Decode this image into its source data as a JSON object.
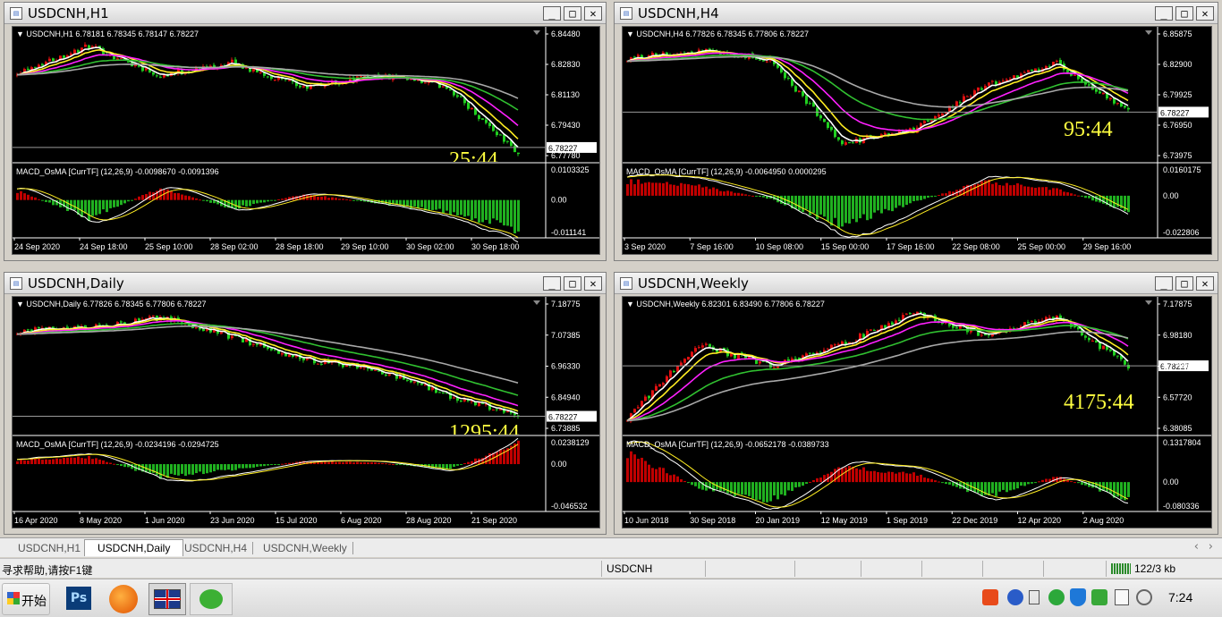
{
  "colors": {
    "up": "#e01010",
    "down": "#20d020",
    "ma_fast": "#ffffff",
    "ma_mid": "#ffee22",
    "ma_pink": "#ff20ff",
    "ma_green": "#30c030",
    "ma_grey": "#a8a8a8",
    "timer": "#ffff40",
    "axis_text": "#ffffff",
    "hist_up": "#c00000",
    "hist_down": "#20b020"
  },
  "windows": [
    {
      "title": "USDCNH,H1",
      "legend": "▼ USDCNH,H1  6.78181 6.78345 6.78147 6.78227",
      "price_label": "6.78227",
      "price_ticks": [
        "6.84480",
        "6.82830",
        "6.81130",
        "6.79430",
        "6.77780"
      ],
      "macd_label": "MACD_OsMA [CurrTF] (12,26,9) -0.0098670 -0.0091396",
      "macd_ticks": [
        "0.0103325",
        "0.00",
        "-0.011141"
      ],
      "timer": "25:44",
      "time_ticks": [
        "24 Sep 2020",
        "24 Sep 18:00",
        "25 Sep 10:00",
        "28 Sep 02:00",
        "28 Sep 18:00",
        "29 Sep 10:00",
        "30 Sep 02:00",
        "30 Sep 18:00"
      ]
    },
    {
      "title": "USDCNH,H4",
      "legend": "▼ USDCNH,H4  6.77826 6.78345 6.77806 6.78227",
      "price_label": "6.78227",
      "price_ticks": [
        "6.85875",
        "6.82900",
        "6.79925",
        "6.76950",
        "6.73975"
      ],
      "macd_label": "MACD_OsMA [CurrTF] (12,26,9) -0.0064950 0.0000295",
      "macd_ticks": [
        "0.0160175",
        "0.00",
        "-0.022806"
      ],
      "timer": "95:44",
      "time_ticks": [
        "3 Sep 2020",
        "7 Sep 16:00",
        "10 Sep 08:00",
        "15 Sep 00:00",
        "17 Sep 16:00",
        "22 Sep 08:00",
        "25 Sep 00:00",
        "29 Sep 16:00"
      ]
    },
    {
      "title": "USDCNH,Daily",
      "legend": "▼ USDCNH,Daily  6.77826 6.78345 6.77806 6.78227",
      "price_label": "6.78227",
      "price_ticks": [
        "7.18775",
        "7.07385",
        "6.96330",
        "6.84940",
        "6.73885"
      ],
      "macd_label": "MACD_OsMA [CurrTF] (12,26,9) -0.0234196 -0.0294725",
      "macd_ticks": [
        "0.0238129",
        "0.00",
        "-0.046532"
      ],
      "timer": "1295:44",
      "time_ticks": [
        "16 Apr 2020",
        "8 May 2020",
        "1 Jun 2020",
        "23 Jun 2020",
        "15 Jul 2020",
        "6 Aug 2020",
        "28 Aug 2020",
        "21 Sep 2020"
      ]
    },
    {
      "title": "USDCNH,Weekly",
      "legend": "▼ USDCNH,Weekly  6.82301 6.83490 6.77806 6.78227",
      "price_label": "6.78227",
      "price_ticks": [
        "7.17875",
        "6.98180",
        "6.77900",
        "6.57720",
        "6.38085"
      ],
      "macd_label": "MACD_OsMA [CurrTF] (12,26,9) -0.0652178 -0.0389733",
      "macd_ticks": [
        "0.1317804",
        "0.00",
        "-0.080336"
      ],
      "timer": "4175:44",
      "time_ticks": [
        "10 Jun 2018",
        "30 Sep 2018",
        "20 Jan 2019",
        "12 May 2019",
        "1 Sep 2019",
        "22 Dec 2019",
        "12 Apr 2020",
        "2 Aug 2020"
      ]
    }
  ],
  "chart_data": [
    {
      "type": "line",
      "title": "USDCNH,H1",
      "symbol": "USDCNH",
      "ohlc_last": {
        "open": 6.78181,
        "high": 6.78345,
        "low": 6.78147,
        "close": 6.78227
      },
      "ylim": [
        6.7778,
        6.8448
      ],
      "x": [
        "24 Sep 2020",
        "24 Sep 18:00",
        "25 Sep 10:00",
        "28 Sep 02:00",
        "28 Sep 18:00",
        "29 Sep 10:00",
        "30 Sep 02:00",
        "30 Sep 18:00"
      ],
      "series": [
        {
          "name": "USDCNH,H1",
          "values": [
            6.824,
            6.838,
            6.822,
            6.829,
            6.815,
            6.822,
            6.816,
            6.779
          ]
        }
      ],
      "macd": {
        "values": [
          0.003,
          -0.006,
          0.004,
          -0.003,
          0.002,
          -0.001,
          -0.004,
          -0.01
        ],
        "ylim": [
          -0.011141,
          0.0103325
        ]
      }
    },
    {
      "type": "line",
      "title": "USDCNH,H4",
      "symbol": "USDCNH",
      "ohlc_last": {
        "open": 6.77826,
        "high": 6.78345,
        "low": 6.77806,
        "close": 6.78227
      },
      "ylim": [
        6.73975,
        6.85875
      ],
      "x": [
        "3 Sep 2020",
        "7 Sep 16:00",
        "10 Sep 08:00",
        "15 Sep 00:00",
        "17 Sep 16:00",
        "22 Sep 08:00",
        "25 Sep 00:00",
        "29 Sep 16:00"
      ],
      "series": [
        {
          "name": "USDCNH,H4",
          "values": [
            6.835,
            6.842,
            6.834,
            6.752,
            6.765,
            6.808,
            6.83,
            6.782
          ]
        }
      ],
      "macd": {
        "values": [
          0.009,
          0.006,
          -0.002,
          -0.018,
          -0.004,
          0.009,
          0.004,
          -0.009
        ],
        "ylim": [
          -0.022806,
          0.0160175
        ]
      }
    },
    {
      "type": "line",
      "title": "USDCNH,Daily",
      "symbol": "USDCNH",
      "ohlc_last": {
        "open": 6.77826,
        "high": 6.78345,
        "low": 6.77806,
        "close": 6.78227
      },
      "ylim": [
        6.73885,
        7.18775
      ],
      "x": [
        "16 Apr 2020",
        "8 May 2020",
        "1 Jun 2020",
        "23 Jun 2020",
        "15 Jul 2020",
        "6 Aug 2020",
        "28 Aug 2020",
        "21 Sep 2020"
      ],
      "series": [
        {
          "name": "USDCNH,Daily",
          "values": [
            7.09,
            7.1,
            7.14,
            7.07,
            6.99,
            6.95,
            6.86,
            6.78
          ]
        }
      ],
      "macd": {
        "values": [
          0.004,
          0.008,
          -0.014,
          -0.006,
          0.003,
          0.002,
          -0.006,
          0.022
        ],
        "ylim": [
          -0.046532,
          0.0238129
        ]
      }
    },
    {
      "type": "line",
      "title": "USDCNH,Weekly",
      "symbol": "USDCNH",
      "ohlc_last": {
        "open": 6.82301,
        "high": 6.8349,
        "low": 6.77806,
        "close": 6.78227
      },
      "ylim": [
        6.38085,
        7.17875
      ],
      "x": [
        "10 Jun 2018",
        "30 Sep 2018",
        "20 Jan 2019",
        "12 May 2019",
        "1 Sep 2019",
        "22 Dec 2019",
        "12 Apr 2020",
        "2 Aug 2020"
      ],
      "series": [
        {
          "name": "USDCNH,Weekly",
          "values": [
            6.45,
            6.92,
            6.78,
            6.92,
            7.12,
            6.98,
            7.1,
            6.78
          ]
        }
      ],
      "macd": {
        "values": [
          0.1,
          -0.02,
          -0.06,
          0.05,
          0.03,
          -0.05,
          0.02,
          -0.06
        ],
        "ylim": [
          -0.080336,
          0.1317804
        ]
      }
    }
  ],
  "tabs": [
    {
      "label": "USDCNH,H1"
    },
    {
      "label": "USDCNH,Daily"
    },
    {
      "label": "USDCNH,H4"
    },
    {
      "label": "USDCNH,Weekly"
    }
  ],
  "status": {
    "help": "寻求帮助,请按F1键",
    "symbol": "USDCNH",
    "traffic": "122/3 kb"
  },
  "taskbar": {
    "start": "开始",
    "ps": "Ps",
    "time": "7:24"
  },
  "window_buttons": {
    "min": "_",
    "max": "□",
    "close": "✕"
  },
  "icons": {
    "window": "chart-window-icon",
    "scroll_left": "‹",
    "scroll_right": "›"
  }
}
